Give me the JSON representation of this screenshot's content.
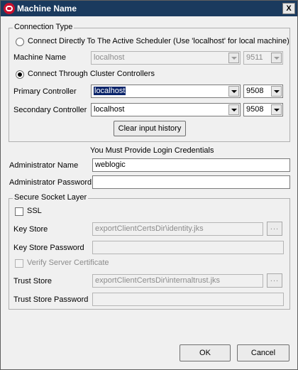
{
  "window": {
    "title": "Machine Name",
    "close_label": "X"
  },
  "connection": {
    "legend": "Connection Type",
    "direct_label": "Connect Directly To The Active Scheduler (Use 'localhost' for local machine)",
    "machine_name_label": "Machine Name",
    "machine_name_value": "localhost",
    "machine_port_value": "9511",
    "cluster_label": "Connect Through Cluster Controllers",
    "primary_label": "Primary Controller",
    "primary_value": "localhost",
    "primary_port": "9508",
    "secondary_label": "Secondary Controller",
    "secondary_value": "localhost",
    "secondary_port": "9508",
    "clear_history_label": "Clear input history"
  },
  "credentials": {
    "heading": "You Must Provide Login Credentials",
    "admin_name_label": "Administrator Name",
    "admin_name_value": "weblogic",
    "admin_password_label": "Administrator Password",
    "admin_password_value": ""
  },
  "ssl": {
    "legend": "Secure Socket Layer",
    "ssl_label": "SSL",
    "key_store_label": "Key Store",
    "key_store_value": "exportClientCertsDir\\identity.jks",
    "key_store_browse": "...",
    "key_store_password_label": "Key Store Password",
    "verify_label": "Verify Server Certificate",
    "trust_store_label": "Trust Store",
    "trust_store_value": "exportClientCertsDir\\internaltrust.jks",
    "trust_store_browse": "...",
    "trust_store_password_label": "Trust Store Password"
  },
  "footer": {
    "ok_label": "OK",
    "cancel_label": "Cancel"
  }
}
